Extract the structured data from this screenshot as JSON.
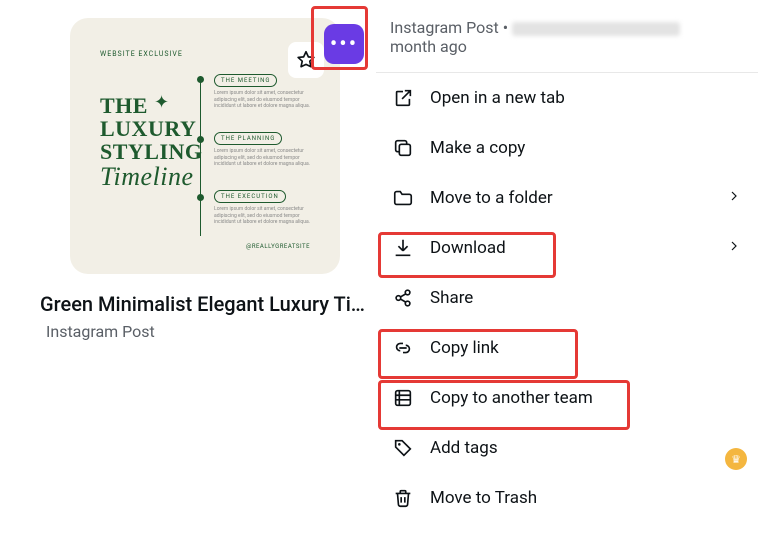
{
  "card": {
    "title": "Green Minimalist Elegant Luxury Tim…",
    "subtitle": "Instagram Post",
    "thumb": {
      "topLabel": "WEBSITE EXCLUSIVE",
      "heading_l1": "THE",
      "heading_l2": "LUXURY",
      "heading_l3": "STYLING",
      "heading_script": "Timeline",
      "steps": [
        "THE MEETING",
        "THE PLANNING",
        "THE EXECUTION"
      ],
      "blurb": "Lorem ipsum dolor sit amet, consectetur adipiscing elit, sed do eiusmod tempor incididunt ut labore et dolore magna aliqua.",
      "handle": "@REALLYGREATSITE"
    }
  },
  "header": {
    "type": "Instagram Post",
    "sep": "•",
    "edited_suffix": "month ago"
  },
  "menu": {
    "open_tab": "Open in a new tab",
    "make_copy": "Make a copy",
    "move_folder": "Move to a folder",
    "download": "Download",
    "share": "Share",
    "copy_link": "Copy link",
    "copy_team": "Copy to another team",
    "add_tags": "Add tags",
    "move_trash": "Move to Trash"
  }
}
